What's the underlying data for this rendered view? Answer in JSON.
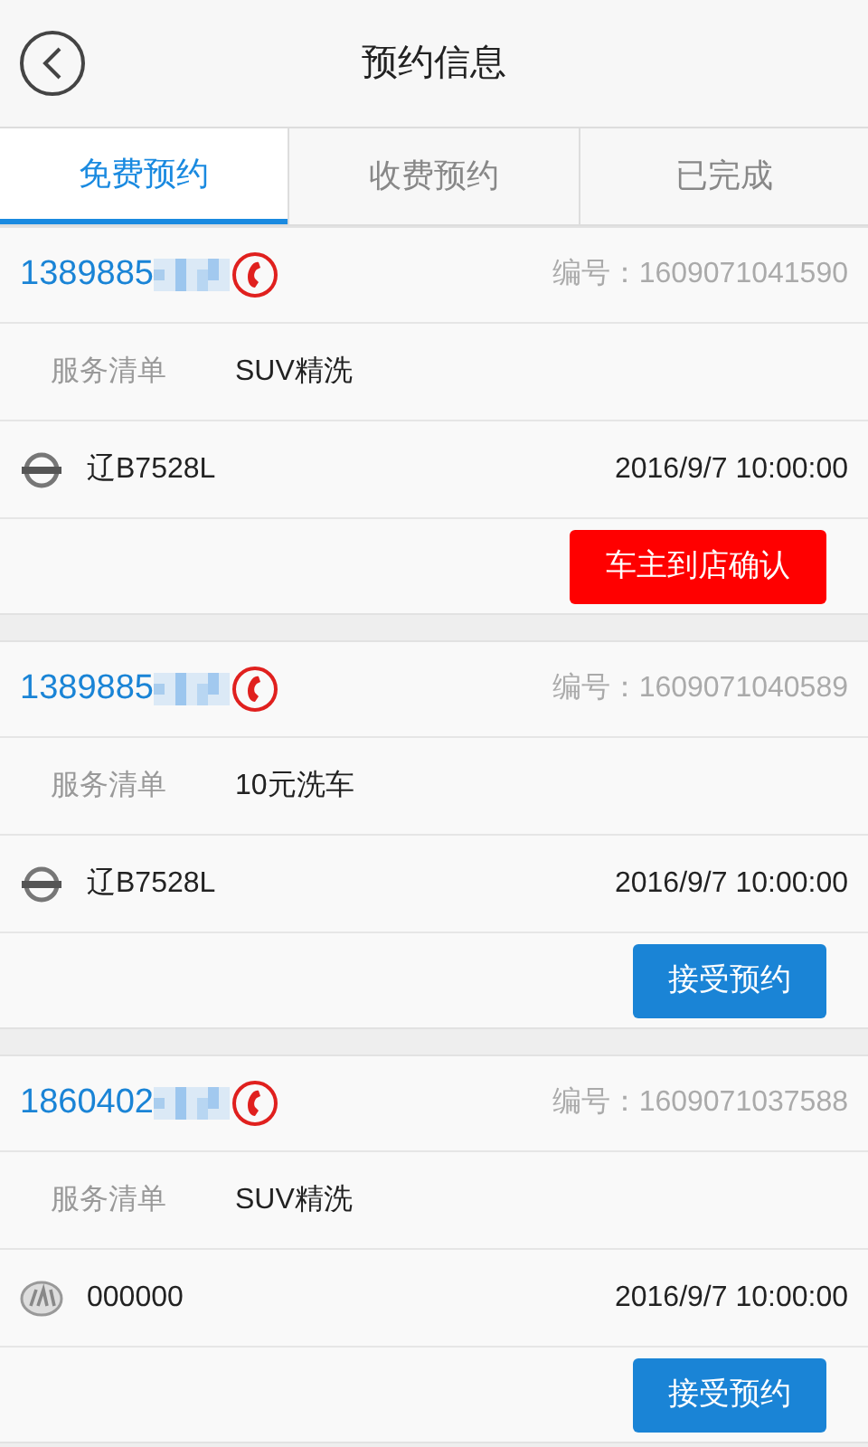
{
  "header": {
    "title": "预约信息"
  },
  "tabs": [
    {
      "label": "免费预约",
      "selected": true
    },
    {
      "label": "收费预约",
      "selected": false
    },
    {
      "label": "已完成",
      "selected": false
    }
  ],
  "orders": [
    {
      "phone": "1389885",
      "number_label": "编号：",
      "number": "1609071041590",
      "service_label": "服务清单",
      "service": "SUV精洗",
      "car": {
        "kind": "nissan",
        "plate": "辽B7528L"
      },
      "time": "2016/9/7 10:00:00",
      "action": {
        "label": "车主到店确认",
        "kind": "confirm"
      }
    },
    {
      "phone": "1389885",
      "number_label": "编号：",
      "number": "1609071040589",
      "service_label": "服务清单",
      "service": "10元洗车",
      "car": {
        "kind": "nissan",
        "plate": "辽B7528L"
      },
      "time": "2016/9/7 10:00:00",
      "action": {
        "label": "接受预约",
        "kind": "accept"
      }
    },
    {
      "phone": "1860402",
      "number_label": "编号：",
      "number": "1609071037588",
      "service_label": "服务清单",
      "service": "SUV精洗",
      "car": {
        "kind": "generic",
        "plate": "000000"
      },
      "time": "2016/9/7 10:00:00",
      "action": {
        "label": "接受预约",
        "kind": "accept"
      }
    }
  ]
}
